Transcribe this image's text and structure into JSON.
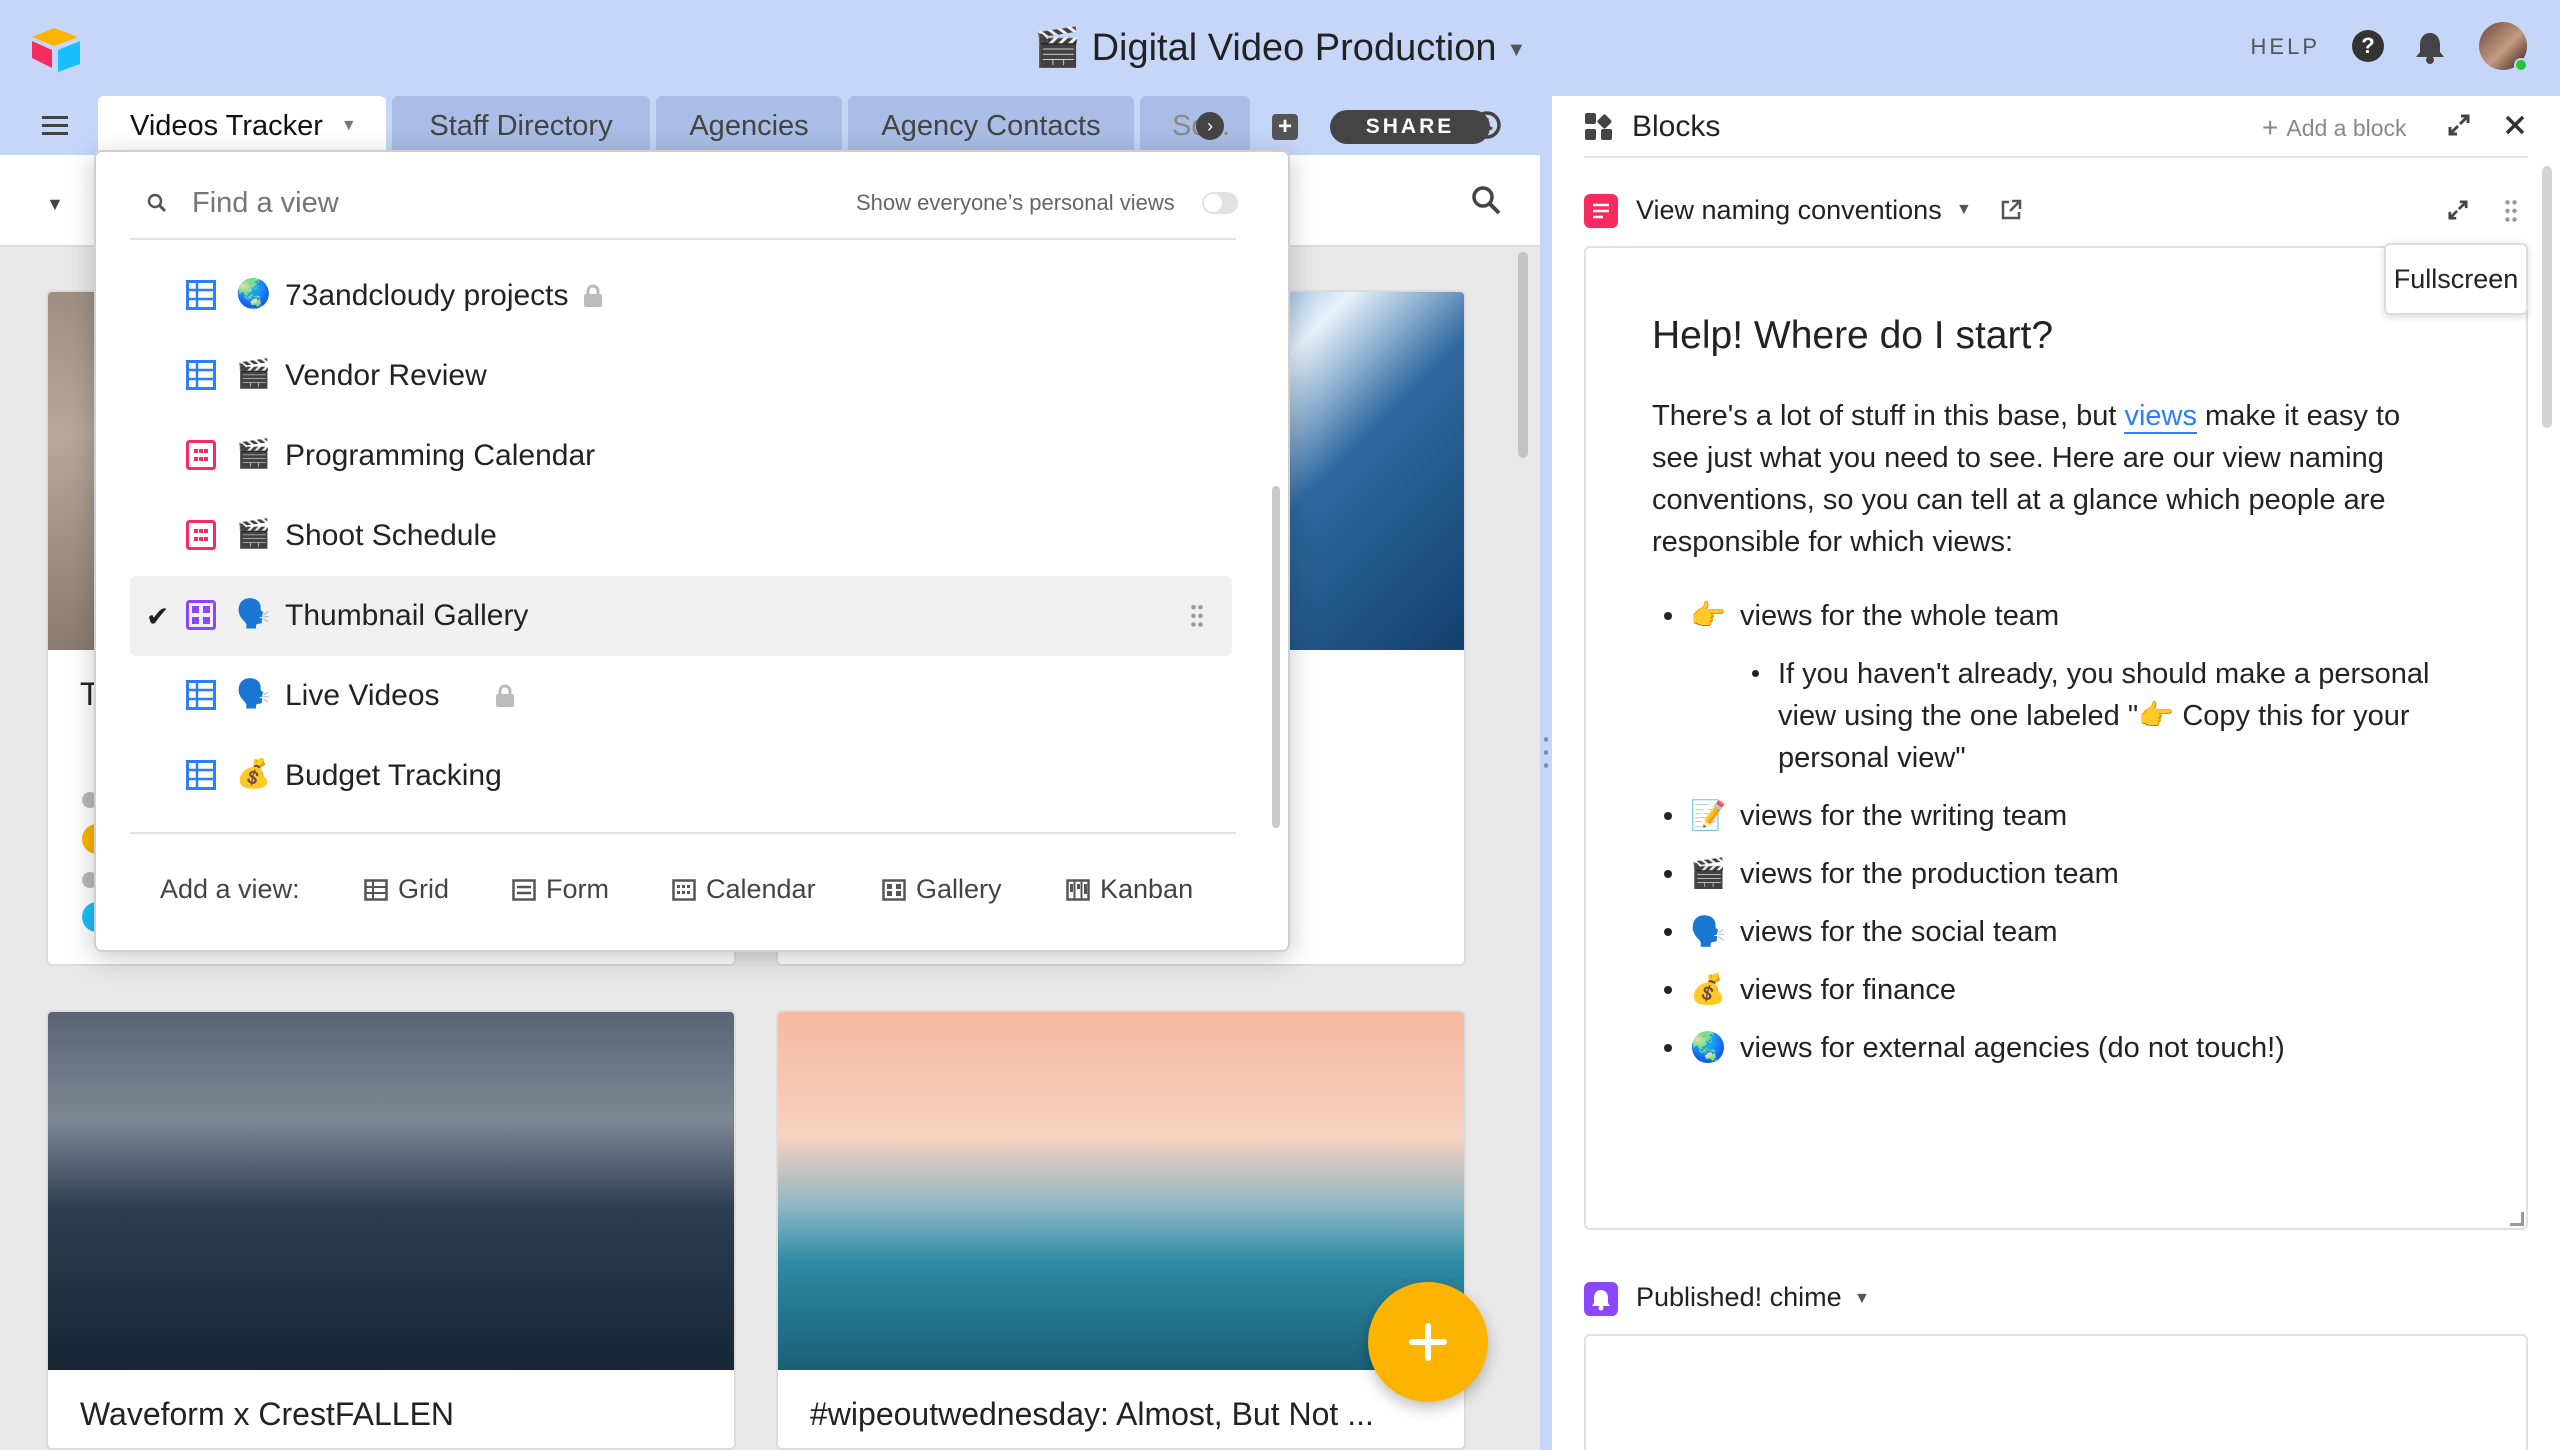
{
  "app": {
    "title": "🎬 Digital Video Production",
    "help_label": "HELP"
  },
  "tabs": [
    {
      "label": "Videos Tracker"
    },
    {
      "label": "Staff Directory"
    },
    {
      "label": "Agencies"
    },
    {
      "label": "Agency Contacts"
    },
    {
      "label": "Sc..."
    }
  ],
  "toolbar": {
    "share_label": "SHARE"
  },
  "view_switcher": {
    "search_placeholder": "Find a view",
    "personal_views_label": "Show everyone’s personal views",
    "views": [
      {
        "icon": "grid-view-icon",
        "emoji": "🌏",
        "name": "73andcloudy projects",
        "locked": true
      },
      {
        "icon": "grid-view-icon",
        "emoji": "🎬",
        "name": "Vendor Review"
      },
      {
        "icon": "calendar-view-icon",
        "emoji": "🎬",
        "name": "Programming Calendar"
      },
      {
        "icon": "calendar-view-icon",
        "emoji": "🎬",
        "name": "Shoot Schedule"
      },
      {
        "icon": "gallery-view-icon",
        "emoji": "🗣️",
        "name": "Thumbnail Gallery",
        "selected": true
      },
      {
        "icon": "grid-view-icon",
        "emoji": "🗣️",
        "name": "Live Videos",
        "locked": true
      },
      {
        "icon": "grid-view-icon",
        "emoji": "💰",
        "name": "Budget Tracking"
      }
    ],
    "add_view_label": "Add a view:",
    "add_view_types": [
      "Grid",
      "Form",
      "Calendar",
      "Gallery",
      "Kanban"
    ]
  },
  "gallery": {
    "cards": [
      {
        "title": "T"
      },
      {
        "title": "Waveform x CrestFALLEN"
      },
      {
        "title": "#wipeoutwednesday: Almost, But Not ..."
      }
    ]
  },
  "blocks": {
    "title": "Blocks",
    "add_block_label": "Add a block",
    "tooltip": "Fullscreen",
    "block1": {
      "name": "View naming conventions",
      "heading": "Help! Where do I start?",
      "intro_before_link": "There's a lot of stuff in this base, but ",
      "intro_link": "views",
      "intro_after_link_1": " make it easy to",
      "intro_line2": "see just what you need to see. Here are our view naming",
      "intro_line3": "conventions, so you can tell at a glance which people are",
      "intro_line4": "responsible for which views:",
      "items": [
        {
          "emoji": "👉",
          "text": "views for the whole team"
        },
        {
          "emoji": "📝",
          "text": "views for the writing team"
        },
        {
          "emoji": "🎬",
          "text": "views for the production team"
        },
        {
          "emoji": "🗣️",
          "text": "views for the social team"
        },
        {
          "emoji": "💰",
          "text": "views for finance"
        },
        {
          "emoji": "🌏",
          "text": "views for external agencies (do not touch!)"
        }
      ],
      "sub_line1": "If you haven't already, you should make a personal",
      "sub_line2_before": "view using the one labeled \"",
      "sub_line2_emoji": "👉",
      "sub_line2_after": " Copy this for your",
      "sub_line3": "personal view\""
    },
    "block2": {
      "name": "Published! chime"
    }
  },
  "colors": {
    "topbar": "#c6d6f8",
    "tab_inactive": "#a9bde6",
    "grid_icon": "#2d7ff9",
    "calendar_icon": "#f82b60",
    "gallery_icon": "#8b46ff",
    "fab": "#fcb400",
    "link": "#2d7ff9"
  }
}
